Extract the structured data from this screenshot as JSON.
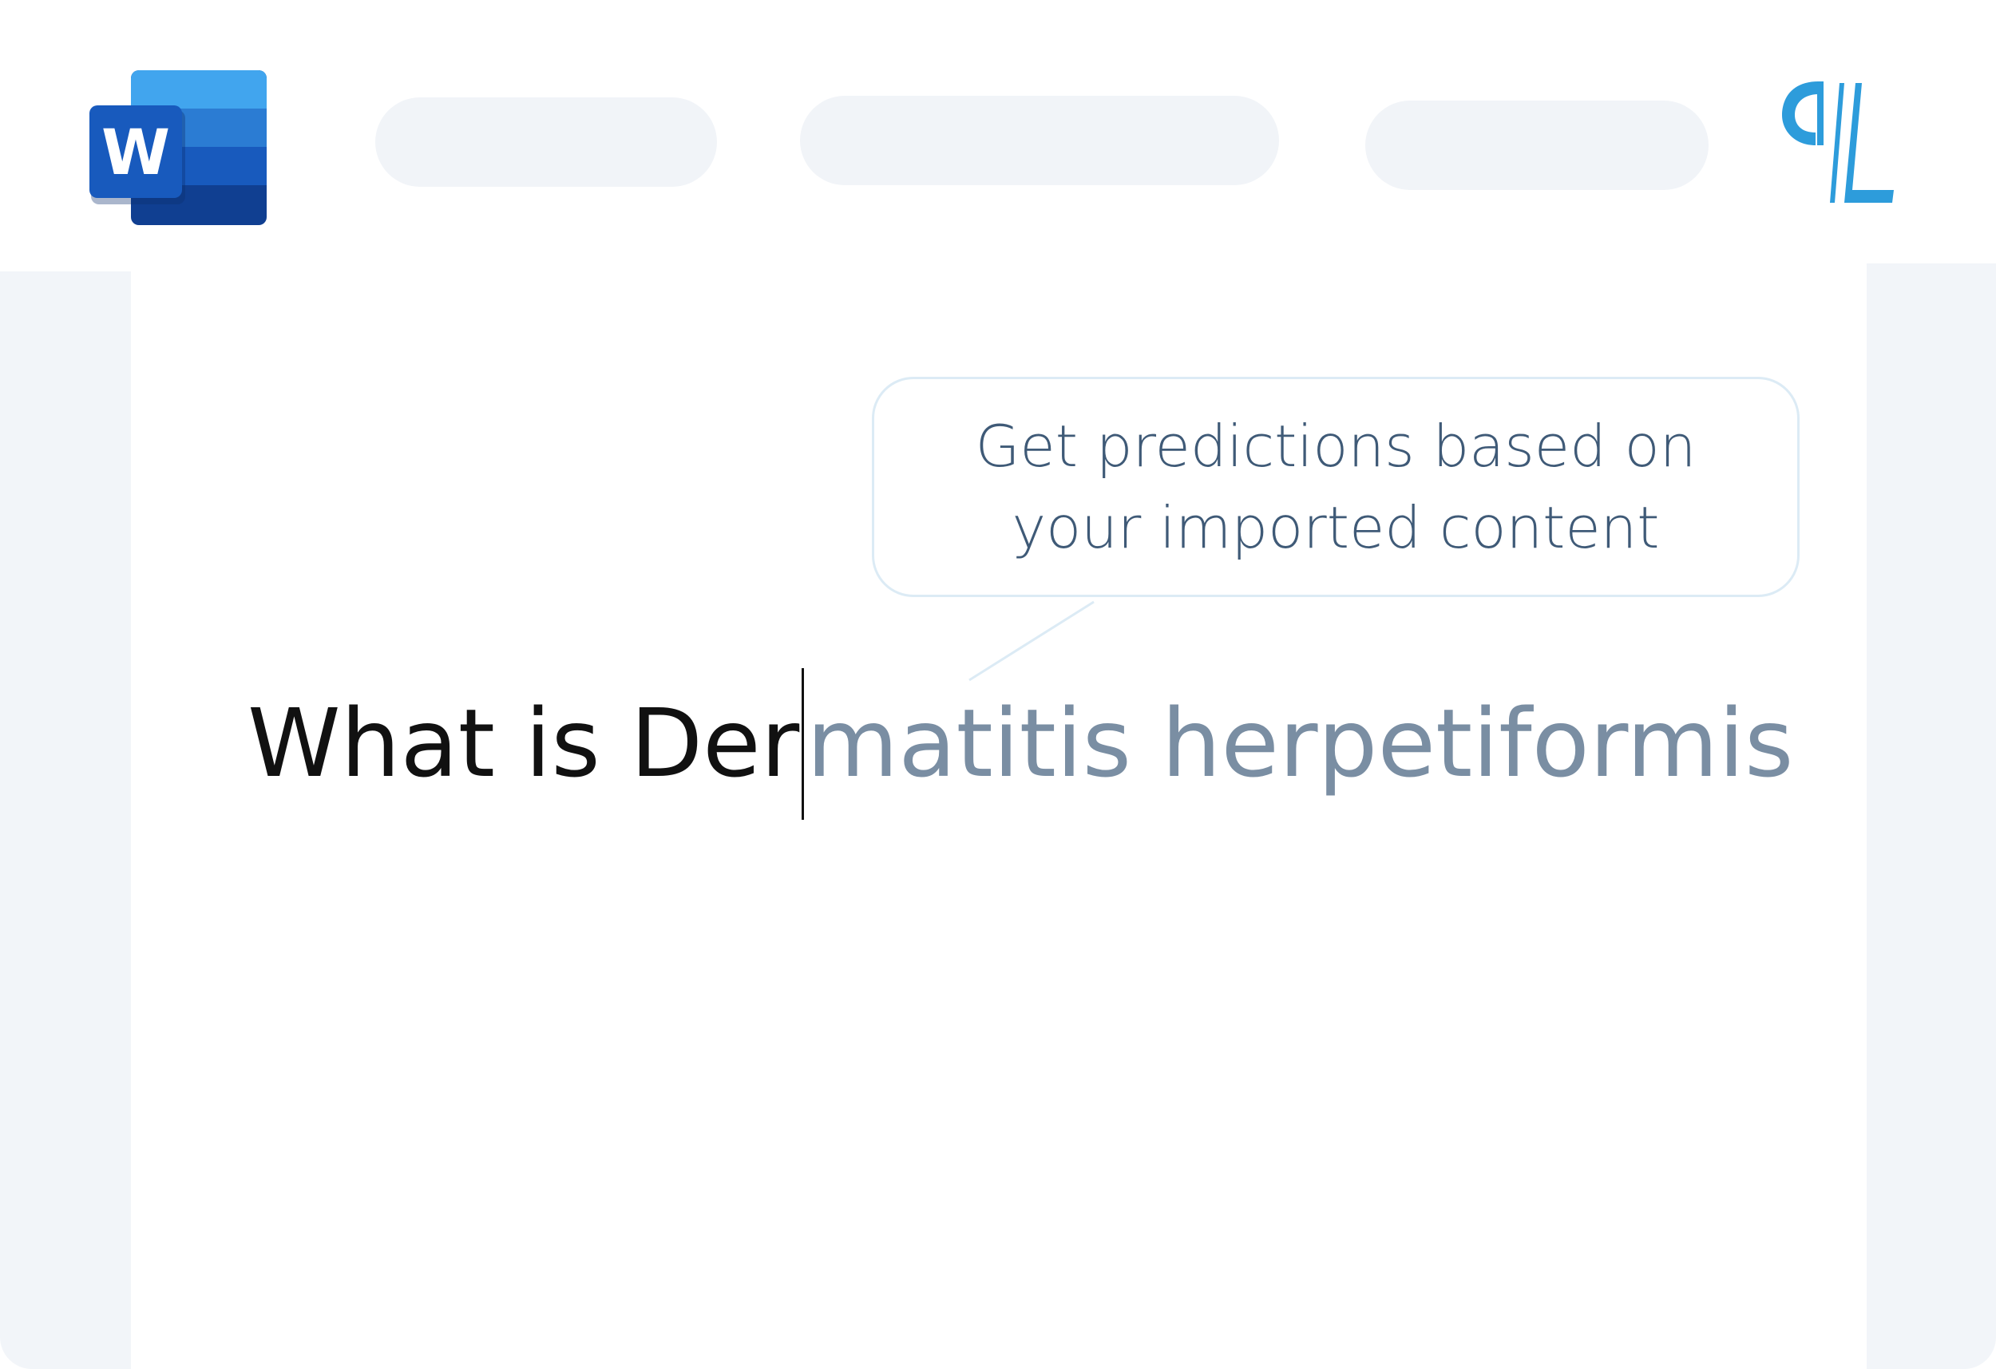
{
  "header": {
    "left_logo": {
      "name": "word-icon",
      "letter": "W",
      "colors": [
        "#41a5ee",
        "#2b7cd3",
        "#185abd",
        "#103f91"
      ]
    },
    "right_logo": {
      "name": "pilcrow-l-icon",
      "color": "#2d9cdb"
    },
    "toolbar_placeholders": 3
  },
  "tooltip": {
    "line1": "Get predictions based on",
    "line2": "your imported content"
  },
  "editor": {
    "typed_text": "What is Der",
    "predicted_text": "matitis herpetiformis"
  },
  "colors": {
    "typed": "#111111",
    "prediction": "#7a8ea3",
    "tooltip_text": "#3f5a77",
    "tooltip_border": "#dcebf5",
    "panel": "#f2f5f9"
  }
}
